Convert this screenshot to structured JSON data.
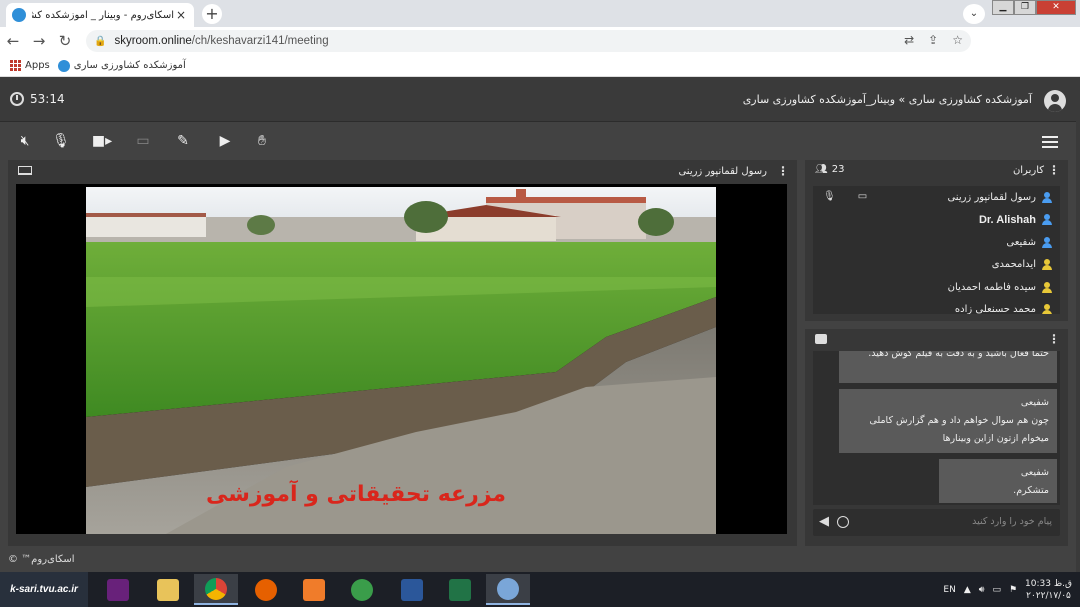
{
  "browser": {
    "tab_title": "اسکای‌روم - وبینار _ آموزشکده کشاورزی",
    "tab_close": "×",
    "new_tab": "+",
    "tab_menu": "⌄",
    "url_domain": "skyroom.online",
    "url_path": "/ch/keshavarzi141/meeting",
    "bookmarks": {
      "apps_label": "Apps",
      "item_label": "آموزشکده کشاورزی ساری"
    }
  },
  "app": {
    "timer": "53:14",
    "breadcrumb": "آموزشکده کشاورزی ساری » وبینار_آموزشکده کشاورزی ساری",
    "copyright": "اسکای‌روم™ ©"
  },
  "video_panel": {
    "presenter": "رسول لقمانپور زرینی",
    "caption": "مزرعه تحقیقاتی و آموزشی"
  },
  "users_panel": {
    "title": "کاربران",
    "count": "23",
    "users": [
      {
        "name": "رسول لقمانپور زرینی",
        "color": "blue",
        "bold": false
      },
      {
        "name": "Dr. Alishah",
        "color": "blue",
        "bold": true
      },
      {
        "name": "شفیعی",
        "color": "blue",
        "bold": false
      },
      {
        "name": "ایدامحمدی",
        "color": "yellow",
        "bold": false
      },
      {
        "name": "سیده فاطمه احمدیان",
        "color": "yellow",
        "bold": false
      },
      {
        "name": "محمد حسنعلی زاده",
        "color": "yellow",
        "bold": false
      }
    ]
  },
  "chat_panel": {
    "messages": [
      {
        "from": "",
        "text": "حتما فعال باشید و به دقت به فیلم گوش دهید."
      },
      {
        "from": "شفیعی",
        "text": "چون هم سوال خواهم داد و هم گزارش کاملی میخوام ازتون ازاین وبینارها"
      },
      {
        "from": "شفیعی",
        "text": "متشکرم."
      }
    ],
    "input_placeholder": "پیام خود را وارد کنید"
  },
  "taskbar": {
    "logo_text": "k-sari.tvu.ac.ir",
    "lang": "EN",
    "time": "ق.ظ 10:33",
    "date": "۲۰۲۲/۱۷/۰۵"
  }
}
